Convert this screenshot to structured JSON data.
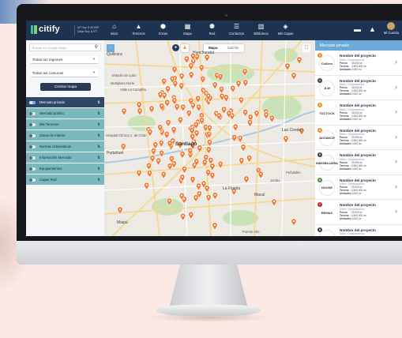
{
  "app": {
    "logo": "citify",
    "uf_line1": "UF Hoy: $ 33.699",
    "uf_line2": "Dólar Hoy: $ 977"
  },
  "nav": {
    "items": [
      {
        "label": "Inicio",
        "icon": "home-icon",
        "glyph": "⌂"
      },
      {
        "label": "Terrenos",
        "icon": "terrain-icon",
        "glyph": "▲"
      },
      {
        "label": "Zonas",
        "icon": "pin-icon",
        "glyph": "⬢"
      },
      {
        "label": "Mapa",
        "icon": "map-icon",
        "glyph": "▦"
      },
      {
        "label": "Red",
        "icon": "network-icon",
        "glyph": "⚉"
      },
      {
        "label": "Contactos",
        "icon": "contacts-icon",
        "glyph": "☰"
      },
      {
        "label": "Biblioteca",
        "icon": "library-icon",
        "glyph": "▥"
      },
      {
        "label": "Mis Capas",
        "icon": "layers-icon",
        "glyph": "◈"
      }
    ],
    "account_label": "Mi Cuenta"
  },
  "left": {
    "search_placeholder": "Buscar en Google Maps",
    "region_select": "Todas las regiones",
    "comuna_select": "Todas las comunas",
    "center_button": "Centrar mapa",
    "layers": [
      {
        "label": "Mercado privado",
        "active": true
      },
      {
        "label": "Mercado público",
        "active": false
      },
      {
        "label": "Mis Terrenos",
        "active": false
      },
      {
        "label": "Zonas de Interés",
        "active": false
      },
      {
        "label": "Normas Urbanísticas",
        "active": false
      },
      {
        "label": "Información Mercado",
        "active": false
      },
      {
        "label": "Equipamientos",
        "active": false
      },
      {
        "label": "Capas Red",
        "active": false
      }
    ]
  },
  "map": {
    "type_map": "Mapa",
    "type_sat": "Satélite",
    "labels": [
      {
        "text": "Quilicura",
        "cls": "mid"
      },
      {
        "text": "Huechuraba",
        "cls": "mid"
      },
      {
        "text": "Estadio de Lobo",
        "cls": ""
      },
      {
        "text": "Valle La Campiña",
        "cls": ""
      },
      {
        "text": "Multiplaza Norte",
        "cls": ""
      },
      {
        "text": "Pudahuel",
        "cls": "mid"
      },
      {
        "text": "Hospital Clínico U. de Chile",
        "cls": ""
      },
      {
        "text": "Santiago",
        "cls": "big"
      },
      {
        "text": "Las Condes",
        "cls": "mid"
      },
      {
        "text": "Maipú",
        "cls": "mid"
      },
      {
        "text": "Macul",
        "cls": "mid"
      },
      {
        "text": "Peñalolén",
        "cls": ""
      },
      {
        "text": "La Florida",
        "cls": "mid"
      },
      {
        "text": "Puente Alto",
        "cls": ""
      },
      {
        "text": "Jumbo",
        "cls": ""
      }
    ]
  },
  "right": {
    "header": "Mercado privado",
    "cards": [
      {
        "rank": "1",
        "rank_color": "#e8922e",
        "brand": "Colliers",
        "title": "Nombre del proyecto",
        "subtitle": "Mixto / Departamento",
        "r1k": "Precio",
        "r1v": "15.000 uf",
        "r2k": "Terreno",
        "r2v": "4.500.000 m²",
        "r3k": "Unidades",
        "r3v": "3.000 m²"
      },
      {
        "rank": "2",
        "rank_color": "#3a3f47",
        "brand": "JLW",
        "title": "Nombre del proyecto",
        "subtitle": "Mixto / Departamento",
        "r1k": "Precio",
        "r1v": "15.000 uf",
        "r2k": "Terreno",
        "r2v": "4.500.000 m²",
        "r3k": "Unidades",
        "r3v": "3.000 m²"
      },
      {
        "rank": "3",
        "rank_color": "#e8922e",
        "brand": "TOCTOCK",
        "title": "Nombre del proyecto",
        "subtitle": "Mixto / Departamento",
        "r1k": "Precio",
        "r1v": "15.000 uf",
        "r2k": "Terreno",
        "r2v": "4.500.000 m²",
        "r3k": "Unidades",
        "r3v": "3.000 m²"
      },
      {
        "rank": "4",
        "rank_color": "#e8922e",
        "brand": "ADVANCE",
        "title": "Nombre del proyecto",
        "subtitle": "Mixto / Departamento",
        "r1k": "Precio",
        "r1v": "15.000 uf",
        "r2k": "Terreno",
        "r2v": "4.500.000 m²",
        "r3k": "Unidades",
        "r3v": "3.000 m²"
      },
      {
        "rank": "5",
        "rank_color": "#3a3f47",
        "brand": "INMOBILIARIA",
        "title": "Nombre del proyecto",
        "subtitle": "Mixto / Departamento",
        "r1k": "Precio",
        "r1v": "15.000 uf",
        "r2k": "Terreno",
        "r2v": "4.500.000 m²",
        "r3k": "Unidades",
        "r3v": "3.000 m²"
      },
      {
        "rank": "6",
        "rank_color": "#5b8c3a",
        "brand": "HOUSE",
        "title": "Nombre del proyecto",
        "subtitle": "Mixto / Departamento",
        "r1k": "Precio",
        "r1v": "15.000 uf",
        "r2k": "Terreno",
        "r2v": "4.500.000 m²",
        "r3k": "Unidades",
        "r3v": "3.000 m²"
      },
      {
        "rank": "7",
        "rank_color": "#c1272d",
        "brand": "REMAX",
        "title": "Nombre del proyecto",
        "subtitle": "Mixto / Departamento",
        "r1k": "Precio",
        "r1v": "15.000 uf",
        "r2k": "Terreno",
        "r2v": "4.500.000 m²",
        "r3k": "Unidades",
        "r3v": "3.000 m²"
      },
      {
        "rank": "8",
        "rank_color": "#3a3f47",
        "brand": "",
        "title": "Nombre del proyecto",
        "subtitle": "Mixto / Departamento",
        "r1k": "",
        "r1v": "",
        "r2k": "",
        "r2v": "",
        "r3k": "",
        "r3v": ""
      }
    ]
  },
  "colors": {
    "navbar": "#1e3350",
    "accent": "#6aa9d8",
    "layer_teal": "#79b8bc",
    "layer_active": "#2f4665",
    "pin": "#ee7a34"
  }
}
